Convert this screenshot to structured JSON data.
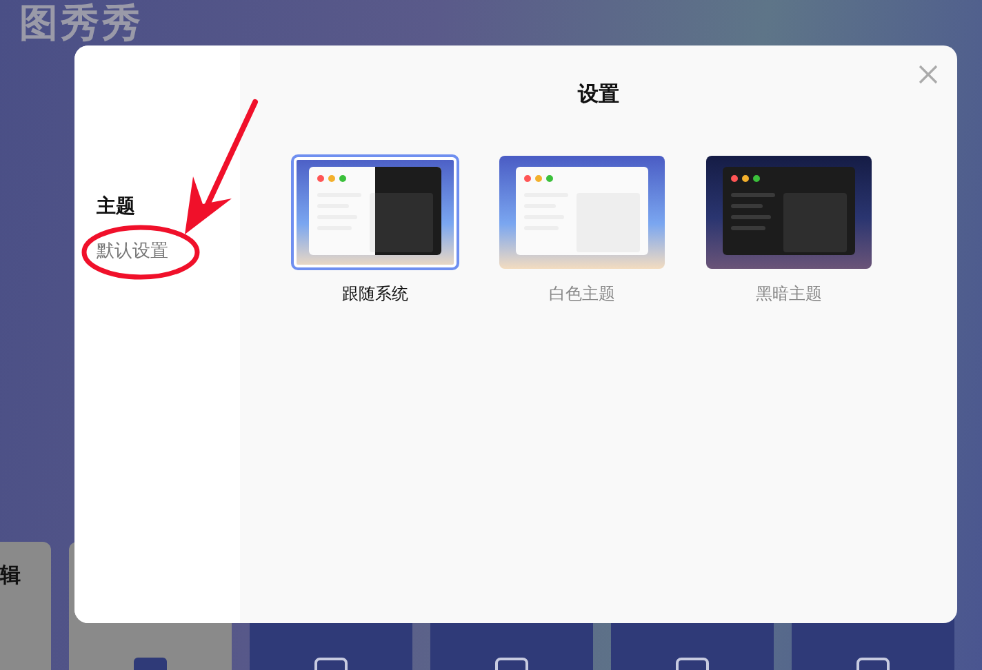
{
  "background": {
    "logo": "图秀秀",
    "side_label": "辑"
  },
  "dialog": {
    "title": "设置",
    "sidebar": {
      "heading": "主题",
      "item": "默认设置"
    },
    "themes": [
      {
        "kind": "system",
        "label": "跟随系统",
        "selected": true
      },
      {
        "kind": "light",
        "label": "白色主题",
        "selected": false
      },
      {
        "kind": "dark",
        "label": "黑暗主题",
        "selected": false
      }
    ]
  }
}
